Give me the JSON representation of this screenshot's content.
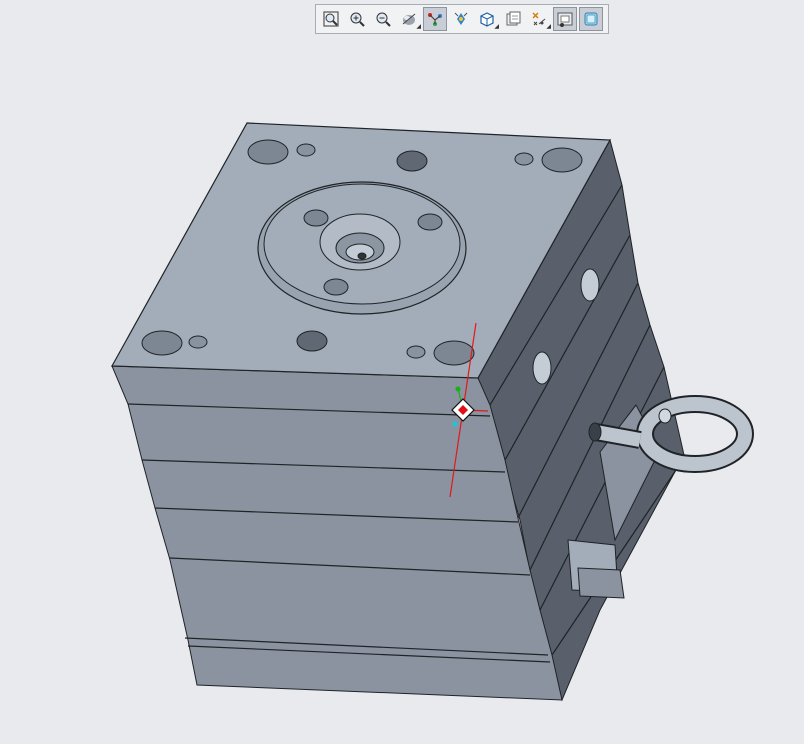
{
  "toolbar": {
    "buttons": [
      {
        "name": "refit-icon",
        "active": false,
        "menu": false
      },
      {
        "name": "zoom-in-icon",
        "active": false,
        "menu": false
      },
      {
        "name": "zoom-out-icon",
        "active": false,
        "menu": false
      },
      {
        "name": "display-style-icon",
        "active": false,
        "menu": true
      },
      {
        "name": "spin-center-icon",
        "active": true,
        "menu": false
      },
      {
        "name": "view-manager-icon",
        "active": false,
        "menu": false
      },
      {
        "name": "saved-views-icon",
        "active": false,
        "menu": true
      },
      {
        "name": "layers-icon",
        "active": false,
        "menu": false
      },
      {
        "name": "datum-display-icon",
        "active": false,
        "menu": true
      },
      {
        "name": "annotation-display-icon",
        "active": true,
        "menu": false
      },
      {
        "name": "model-tree-icon",
        "active": true,
        "menu": false
      }
    ]
  },
  "colors": {
    "background": "#e8eaed",
    "top_face": "#a3adb9",
    "front_face": "#8a939f",
    "side_face": "#59606b",
    "edge": "#1f2327",
    "spin_center": "#e0101a",
    "axis_x": "#e01a1a",
    "axis_y": "#19b019",
    "axis_z": "#19c8d8"
  }
}
